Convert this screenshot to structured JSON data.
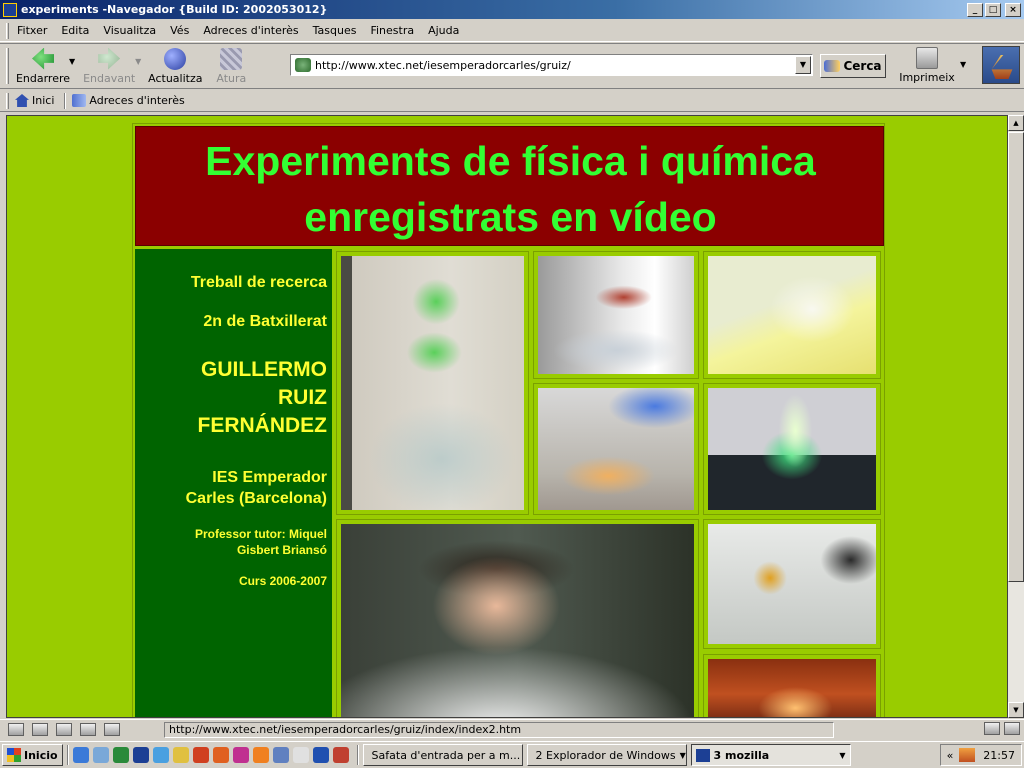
{
  "window": {
    "title": "experiments -Navegador {Build ID: 2002053012}",
    "controls": [
      "_",
      "□",
      "×"
    ]
  },
  "menu": [
    "Fitxer",
    "Edita",
    "Visualitza",
    "Vés",
    "Adreces d'interès",
    "Tasques",
    "Finestra",
    "Ajuda"
  ],
  "toolbar": {
    "back": "Endarrere",
    "forward": "Endavant",
    "reload": "Actualitza",
    "stop": "Atura",
    "search": "Cerca",
    "print": "Imprimeix"
  },
  "address": {
    "url": "http://www.xtec.net/iesemperadorcarles/gruiz/"
  },
  "personal_toolbar": {
    "home": "Inici",
    "bookmarks": "Adreces d'interès"
  },
  "page": {
    "title_line1": "Experiments de física i química",
    "title_line2": "enregistrats en vídeo",
    "sidebar": {
      "line1": "Treball de recerca",
      "line2": "2n de Batxillerat",
      "author_1": "GUILLERMO",
      "author_2": "RUIZ",
      "author_3": "FERNÁNDEZ",
      "school_1": "IES Emperador",
      "school_2": "Carles (Barcelona)",
      "tutor_1": "Professor tutor: Miquel",
      "tutor_2": "Gisbert Briansó",
      "course": "Curs 2006-2007"
    }
  },
  "status": {
    "text": "http://www.xtec.net/iesemperadorcarles/gruiz/index/index2.htm"
  },
  "taskbar": {
    "start": "Inicio",
    "tasks": [
      {
        "label": "Safata d'entrada per a m..."
      },
      {
        "label": "2 Explorador de Windows"
      },
      {
        "label": "3 mozilla"
      }
    ],
    "tray_arrows": "«",
    "clock": "21:57"
  }
}
